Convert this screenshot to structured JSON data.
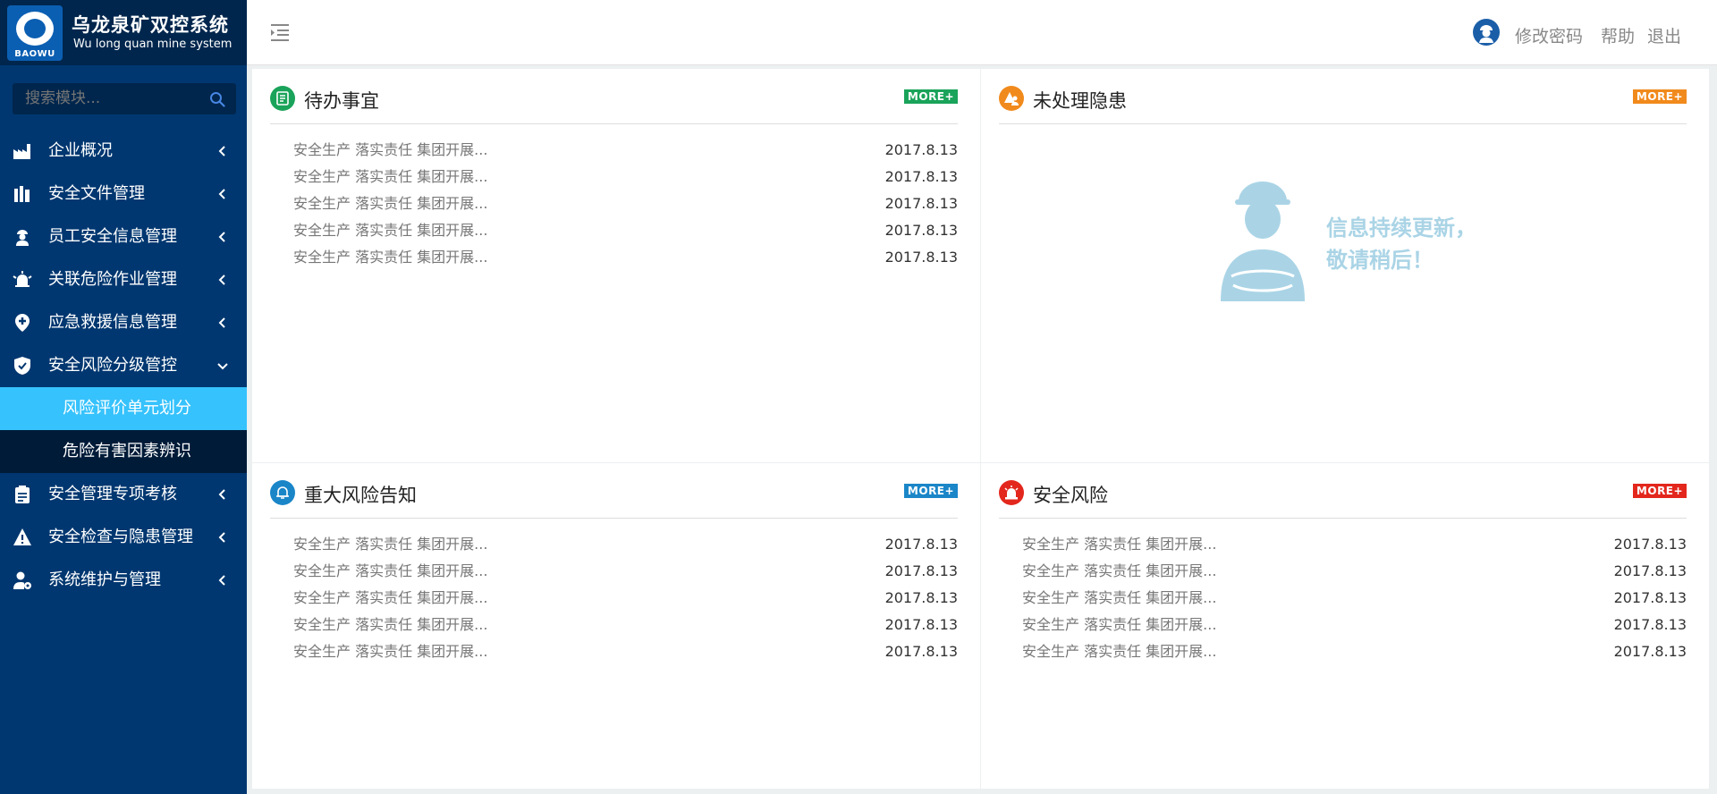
{
  "brand": {
    "title": "乌龙泉矿双控系统",
    "subtitle": "Wu long quan mine system",
    "logo_text": "BAOWU"
  },
  "search": {
    "placeholder": "搜索模块..."
  },
  "menu": [
    {
      "label": "企业概况",
      "icon": "building-icon"
    },
    {
      "label": "安全文件管理",
      "icon": "files-icon"
    },
    {
      "label": "员工安全信息管理",
      "icon": "worker-icon"
    },
    {
      "label": "关联危险作业管理",
      "icon": "alarm-bell-icon"
    },
    {
      "label": "应急救援信息管理",
      "icon": "rescue-icon"
    },
    {
      "label": "安全风险分级管控",
      "icon": "shield-icon",
      "expanded": true
    },
    {
      "label": "安全管理专项考核",
      "icon": "clipboard-icon"
    },
    {
      "label": "安全检查与隐患管理",
      "icon": "warning-icon"
    },
    {
      "label": "系统维护与管理",
      "icon": "user-gear-icon"
    }
  ],
  "submenu": [
    {
      "label": "风险评价单元划分",
      "active": true
    },
    {
      "label": "危险有害因素辨识",
      "active": false
    }
  ],
  "header": {
    "change_password": "修改密码",
    "help": "帮助",
    "logout": "退出"
  },
  "panels": {
    "todo": {
      "title": "待办事宜",
      "more": "MORE+",
      "color": "#1aa35a",
      "items": [
        {
          "text": "安全生产 落实责任 集团开展...",
          "date": "2017.8.13"
        },
        {
          "text": "安全生产 落实责任 集团开展...",
          "date": "2017.8.13"
        },
        {
          "text": "安全生产 落实责任 集团开展...",
          "date": "2017.8.13"
        },
        {
          "text": "安全生产 落实责任 集团开展...",
          "date": "2017.8.13"
        },
        {
          "text": "安全生产 落实责任 集团开展...",
          "date": "2017.8.13"
        }
      ]
    },
    "hazards": {
      "title": "未处理隐患",
      "more": "MORE+",
      "color": "#f18a1c",
      "empty_line1": "信息持续更新，",
      "empty_line2": "敬请稍后！"
    },
    "major_risk": {
      "title": "重大风险告知",
      "more": "MORE+",
      "color": "#1a86c8",
      "items": [
        {
          "text": "安全生产 落实责任 集团开展...",
          "date": "2017.8.13"
        },
        {
          "text": "安全生产 落实责任 集团开展...",
          "date": "2017.8.13"
        },
        {
          "text": "安全生产 落实责任 集团开展...",
          "date": "2017.8.13"
        },
        {
          "text": "安全生产 落实责任 集团开展...",
          "date": "2017.8.13"
        },
        {
          "text": "安全生产 落实责任 集团开展...",
          "date": "2017.8.13"
        }
      ]
    },
    "safety_risk": {
      "title": "安全风险",
      "more": "MORE+",
      "color": "#e3271d",
      "items": [
        {
          "text": "安全生产 落实责任 集团开展...",
          "date": "2017.8.13"
        },
        {
          "text": "安全生产 落实责任 集团开展...",
          "date": "2017.8.13"
        },
        {
          "text": "安全生产 落实责任 集团开展...",
          "date": "2017.8.13"
        },
        {
          "text": "安全生产 落实责任 集团开展...",
          "date": "2017.8.13"
        },
        {
          "text": "安全生产 落实责任 集团开展...",
          "date": "2017.8.13"
        }
      ]
    }
  },
  "colors": {
    "sidebar": "#003770",
    "brand_bg": "#00264d",
    "submenu_bg": "#001b38",
    "submenu_active": "#36c2fd",
    "page_bg": "#ecf0f1",
    "search_text": "#4786e3"
  }
}
